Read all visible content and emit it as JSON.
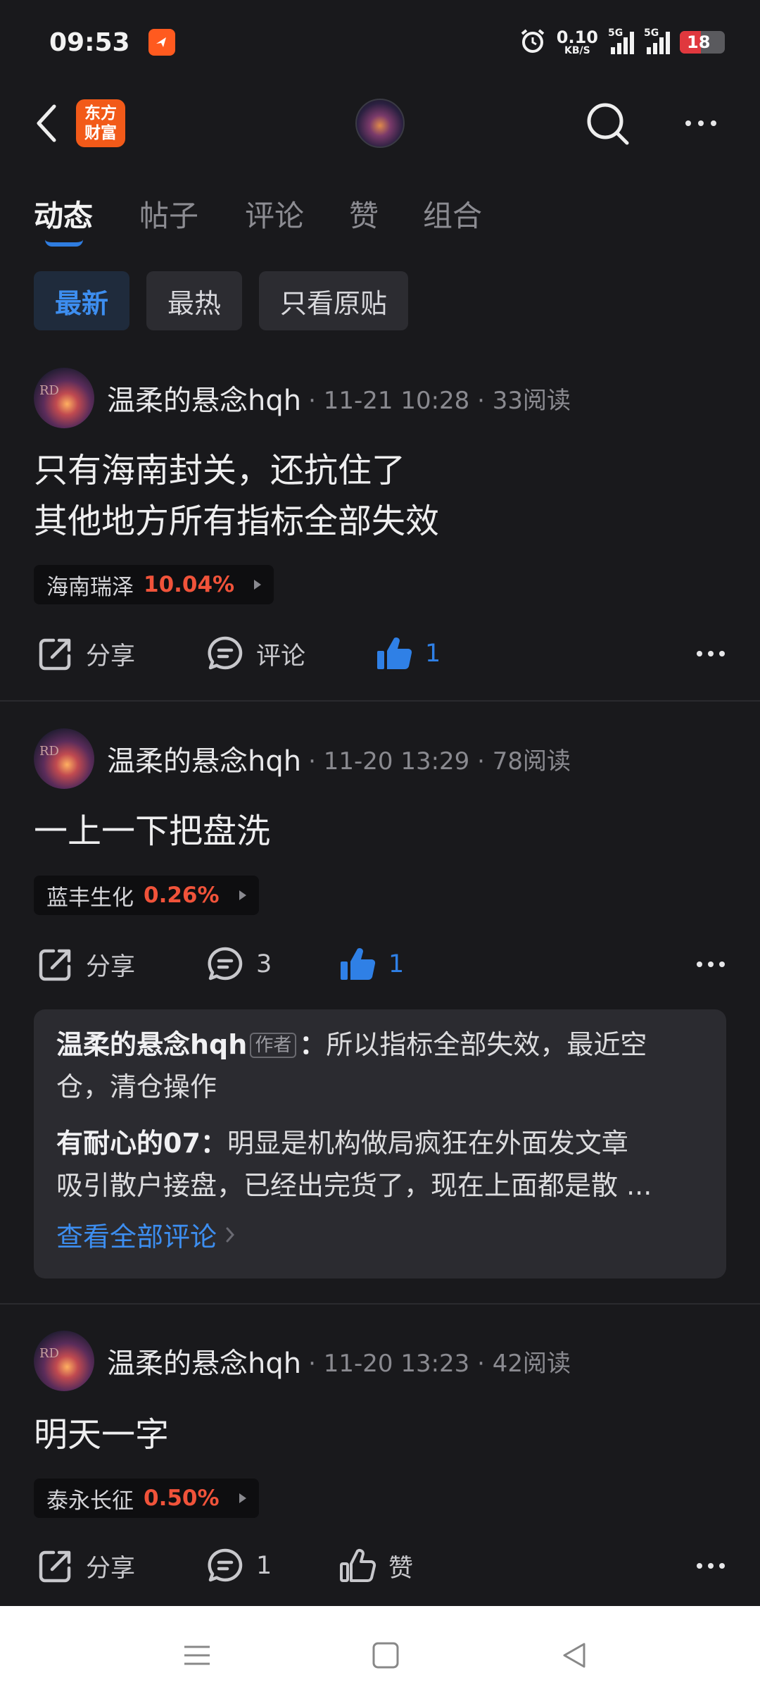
{
  "status_bar": {
    "time": "09:53",
    "net_speed_value": "0.10",
    "net_speed_unit": "KB/S",
    "signal_1": "5G",
    "signal_2": "5G",
    "battery": "18"
  },
  "header": {
    "logo_line1": "东方",
    "logo_line2": "财富"
  },
  "tabs": [
    {
      "label": "动态"
    },
    {
      "label": "帖子"
    },
    {
      "label": "评论"
    },
    {
      "label": "赞"
    },
    {
      "label": "组合"
    }
  ],
  "filters": [
    {
      "label": "最新"
    },
    {
      "label": "最热"
    },
    {
      "label": "只看原贴"
    }
  ],
  "posts": [
    {
      "user": "温柔的悬念hqh",
      "meta": "· 11-21 10:28 · 33阅读",
      "lines": [
        "只有海南封关，还抗住了",
        "其他地方所有指标全部失效"
      ],
      "stock_name": "海南瑞泽",
      "stock_change": "10.04%",
      "share_label": "分享",
      "comment_label": "评论",
      "like_label": "1"
    },
    {
      "user": "温柔的悬念hqh",
      "meta": "· 11-20 13:29 · 78阅读",
      "lines": [
        "一上一下把盘洗"
      ],
      "stock_name": "蓝丰生化",
      "stock_change": "0.26%",
      "share_label": "分享",
      "comment_label": "3",
      "like_label": "1",
      "comments": [
        {
          "user": "温柔的悬念hqh",
          "tag": "作者",
          "line1": "所以指标全部失效，最近空",
          "line2": "仓，清仓操作"
        },
        {
          "user": "有耐心的07",
          "line1": "明显是机构做局疯狂在外面发文章",
          "line2": "吸引散户接盘，已经出完货了，现在上面都是散 ..."
        }
      ],
      "view_all": "查看全部评论"
    },
    {
      "user": "温柔的悬念hqh",
      "meta": "· 11-20 13:23 · 42阅读",
      "lines": [
        "明天一字"
      ],
      "stock_name": "泰永长征",
      "stock_change": "0.50%",
      "share_label": "分享",
      "comment_label": "1",
      "like_label": "赞"
    }
  ]
}
